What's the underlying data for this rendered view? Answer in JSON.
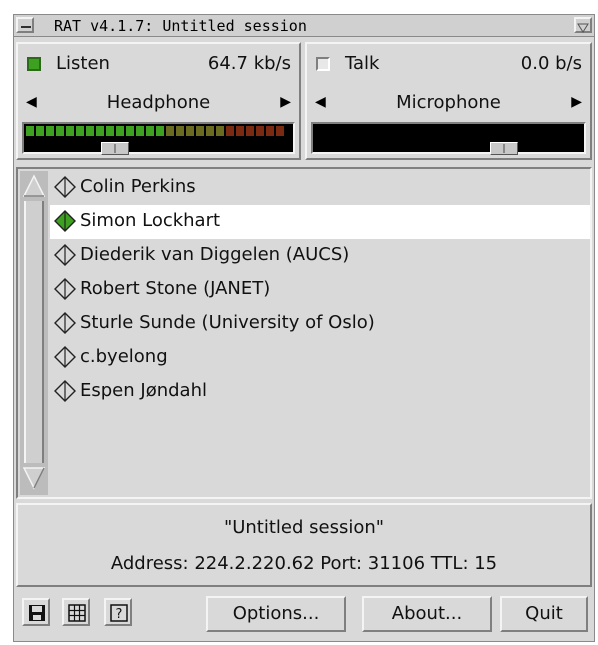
{
  "window": {
    "title": "RAT v4.1.7: Untitled session"
  },
  "listen": {
    "label": "Listen",
    "rate": "64.7 kb/s",
    "enabled": true,
    "device": "Headphone",
    "level_fraction": 0.55,
    "volume_fraction": 0.32
  },
  "talk": {
    "label": "Talk",
    "rate": "0.0 b/s",
    "enabled": false,
    "device": "Microphone",
    "level_fraction": 0,
    "volume_fraction": 0.73
  },
  "participants": [
    {
      "name": "Colin Perkins",
      "active": false,
      "selected": false
    },
    {
      "name": "Simon Lockhart",
      "active": true,
      "selected": true
    },
    {
      "name": "Diederik van Diggelen (AUCS)",
      "active": false,
      "selected": false
    },
    {
      "name": "Robert Stone (JANET)",
      "active": false,
      "selected": false
    },
    {
      "name": "Sturle Sunde (University of Oslo)",
      "active": false,
      "selected": false
    },
    {
      "name": "c.byelong",
      "active": false,
      "selected": false
    },
    {
      "name": "Espen Jøndahl",
      "active": false,
      "selected": false
    }
  ],
  "session": {
    "title": "\"Untitled session\"",
    "address_line": "Address: 224.2.220.62 Port: 31106 TTL: 15"
  },
  "buttons": {
    "save_icon": "floppy-disk-icon",
    "grid_icon": "grid-icon",
    "help_icon": "help-question-icon",
    "options": "Options...",
    "about": "About...",
    "quit": "Quit"
  },
  "colors": {
    "led_on": "#3ea020",
    "led_mid": "#6a6a20",
    "led_hot": "#7a2a10",
    "active_participant": "#3ea020"
  }
}
